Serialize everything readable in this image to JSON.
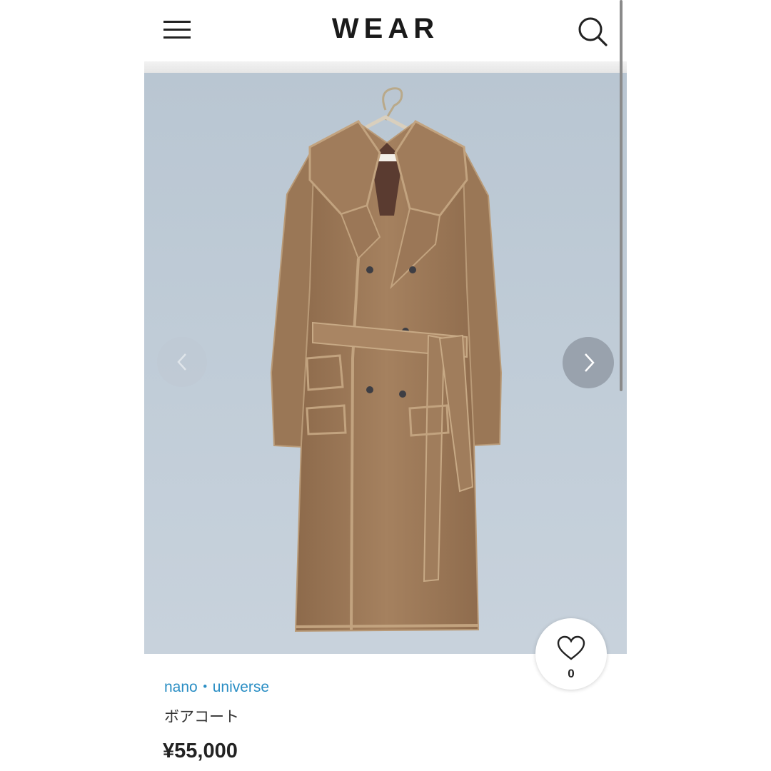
{
  "header": {
    "logo": "WEAR",
    "menu_icon": "hamburger-menu-icon",
    "search_icon": "search-icon"
  },
  "carousel": {
    "prev_icon": "chevron-left-icon",
    "next_icon": "chevron-right-icon"
  },
  "like": {
    "icon": "heart-icon",
    "count": "0"
  },
  "product": {
    "brand": "nano・universe",
    "name": "ボアコート",
    "price": "¥55,000"
  },
  "colors": {
    "accent_link": "#2a8ec4",
    "background_photo": "#c1cdd8",
    "coat": "#9e7b5a"
  }
}
